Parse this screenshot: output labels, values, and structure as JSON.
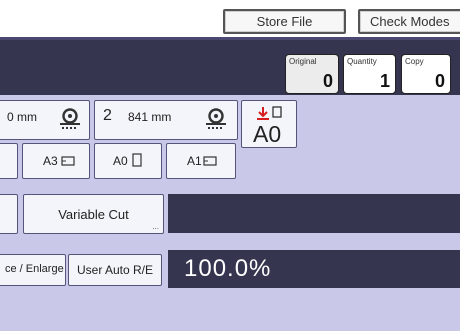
{
  "top_buttons": {
    "store_file": "Store File",
    "check_modes": "Check Modes"
  },
  "counters": {
    "original": {
      "label": "Original",
      "value": "0"
    },
    "quantity": {
      "label": "Quantity",
      "value": "1"
    },
    "copy": {
      "label": "Copy",
      "value": "0"
    }
  },
  "paper_rolls": [
    {
      "number": "",
      "width": "0 mm"
    },
    {
      "number": "2",
      "width": "841 mm"
    }
  ],
  "original_size": {
    "value": "A0"
  },
  "paper_sizes": [
    "A3",
    "A0",
    "A1"
  ],
  "cut": {
    "variable_cut": "Variable Cut",
    "more": "..."
  },
  "reduce": {
    "reduce_enlarge": "ce / Enlarge",
    "user_auto": "User Auto R/E",
    "ratio": "100.0%"
  },
  "colors": {
    "dark": "#35354f",
    "background": "#c9c8e9",
    "accent_red": "#d61e1e"
  }
}
